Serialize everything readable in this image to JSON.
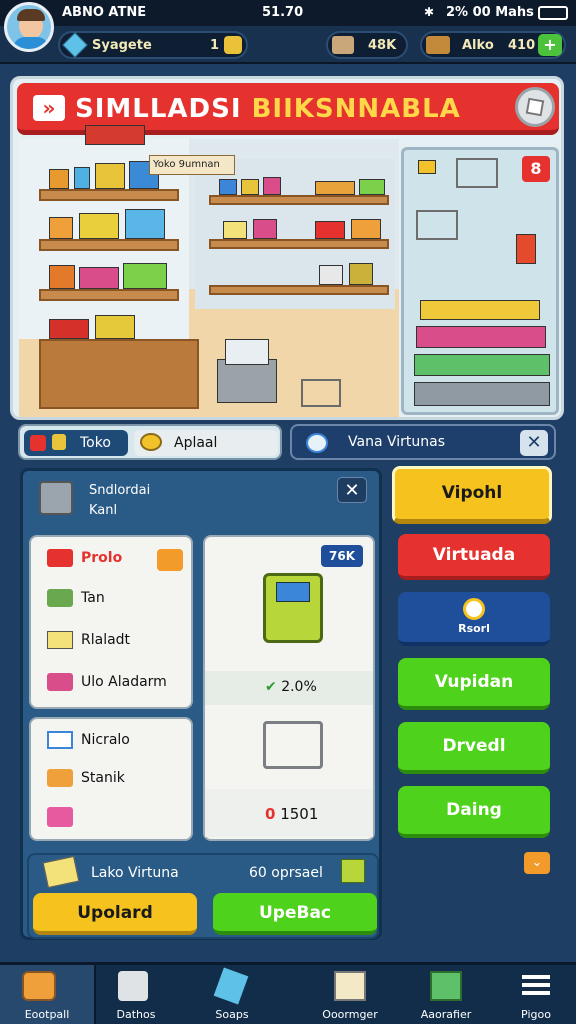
{
  "status": {
    "left": "ABNO ATNE",
    "time": "51.70",
    "battery": "2% 00 Mahs"
  },
  "resources": {
    "coins_label": "Syagete",
    "coins_value": "1",
    "boxes_value": "48K",
    "cash_label": "Alko",
    "cash_value": "410"
  },
  "game": {
    "title_part1": "SIMLLADSI",
    "title_part2": "BIIKSNNABLA",
    "room_sign": "Yoko 9umnan",
    "badge": "8"
  },
  "tabs": {
    "tab1": "Toko",
    "tab2": "Aplaal",
    "tab3": "Vana Virtunas"
  },
  "main": {
    "header_line1": "Sndlordai",
    "header_line2": "Kanl",
    "list1": [
      "Prolo",
      "Tan",
      "Rlaladt",
      "Ulo Aladarm"
    ],
    "list2": [
      "Nicralo",
      "Stanik",
      ""
    ],
    "product_badge": "76K",
    "product_percent": "2.0%",
    "product_count": "1501",
    "product_count_prefix": "0",
    "footer_left": "Lako Virtuna",
    "footer_right": "60 oprsael",
    "btn_left": "Upolard",
    "btn_right": "UpeBac"
  },
  "side_buttons": [
    "Vipohl",
    "Virtuada",
    "Rsorl",
    "Vupidan",
    "Drvedl",
    "Daing"
  ],
  "nav": [
    "Eootpall",
    "Dathos",
    "Soaps",
    "Ooormger",
    "Aaorafier",
    "Pigoo"
  ],
  "colors": {
    "red": "#e6322e",
    "yellow": "#f6c21d",
    "green": "#4ed21b",
    "blue": "#1f4f9b"
  }
}
